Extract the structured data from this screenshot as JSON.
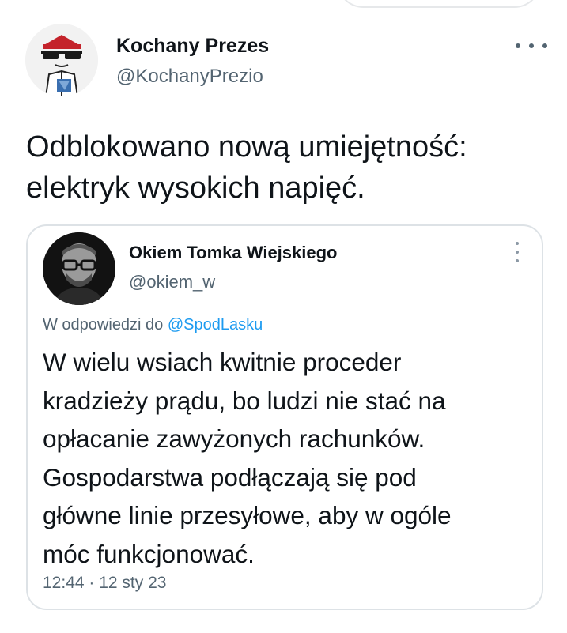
{
  "tweet": {
    "author": {
      "name": "Kochany Prezes",
      "handle": "@KochanyPrezio"
    },
    "text_lines": [
      "Odblokowano nową umiejętność:",
      "elektryk wysokich napięć."
    ]
  },
  "quoted_tweet": {
    "author": {
      "name": "Okiem Tomka Wiejskiego",
      "handle": "@okiem_w"
    },
    "reply_prefix": "W odpowiedzi do",
    "reply_mention": "@SpodLasku",
    "text_lines": [
      "W wielu wsiach kwitnie proceder",
      "kradzieży prądu, bo ludzi nie stać na",
      "opłacanie zawyżonych rachunków.",
      "Gospodarstwa podłączają się pod",
      "główne linie przesyłowe, aby w ogóle",
      "móc funkcjonować."
    ],
    "meta": "12:44 · 12 sty 23"
  },
  "icons": {
    "more_horizontal": "more-horizontal-icon",
    "more_vertical": "more-vertical-icon"
  },
  "colors": {
    "text_primary": "#0f1419",
    "text_secondary": "#536471",
    "link": "#1d9bf0",
    "border": "#dde2e6"
  }
}
